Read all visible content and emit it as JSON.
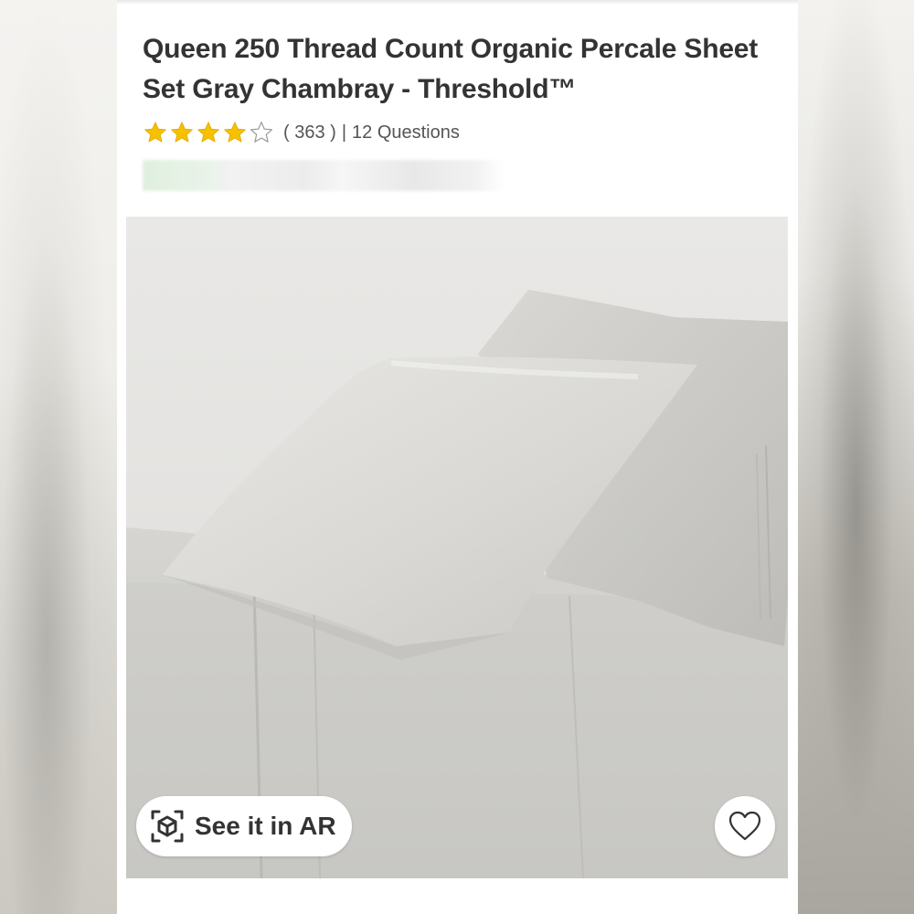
{
  "product": {
    "title": "Queen 250 Thread Count Organic Percale Sheet Set Gray Chambray - Threshold™",
    "rating": 4,
    "rating_max": 5,
    "review_count": "( 363 )",
    "separator": "|",
    "questions": "12 Questions"
  },
  "hero": {
    "ar_label": "See it in AR",
    "ar_icon": "ar-cube-icon",
    "favorite_icon": "heart-outline-icon"
  },
  "colors": {
    "title_text": "#333333",
    "star_filled": "#f5c100",
    "star_empty_outline": "#999999",
    "meta_text": "#555555"
  }
}
